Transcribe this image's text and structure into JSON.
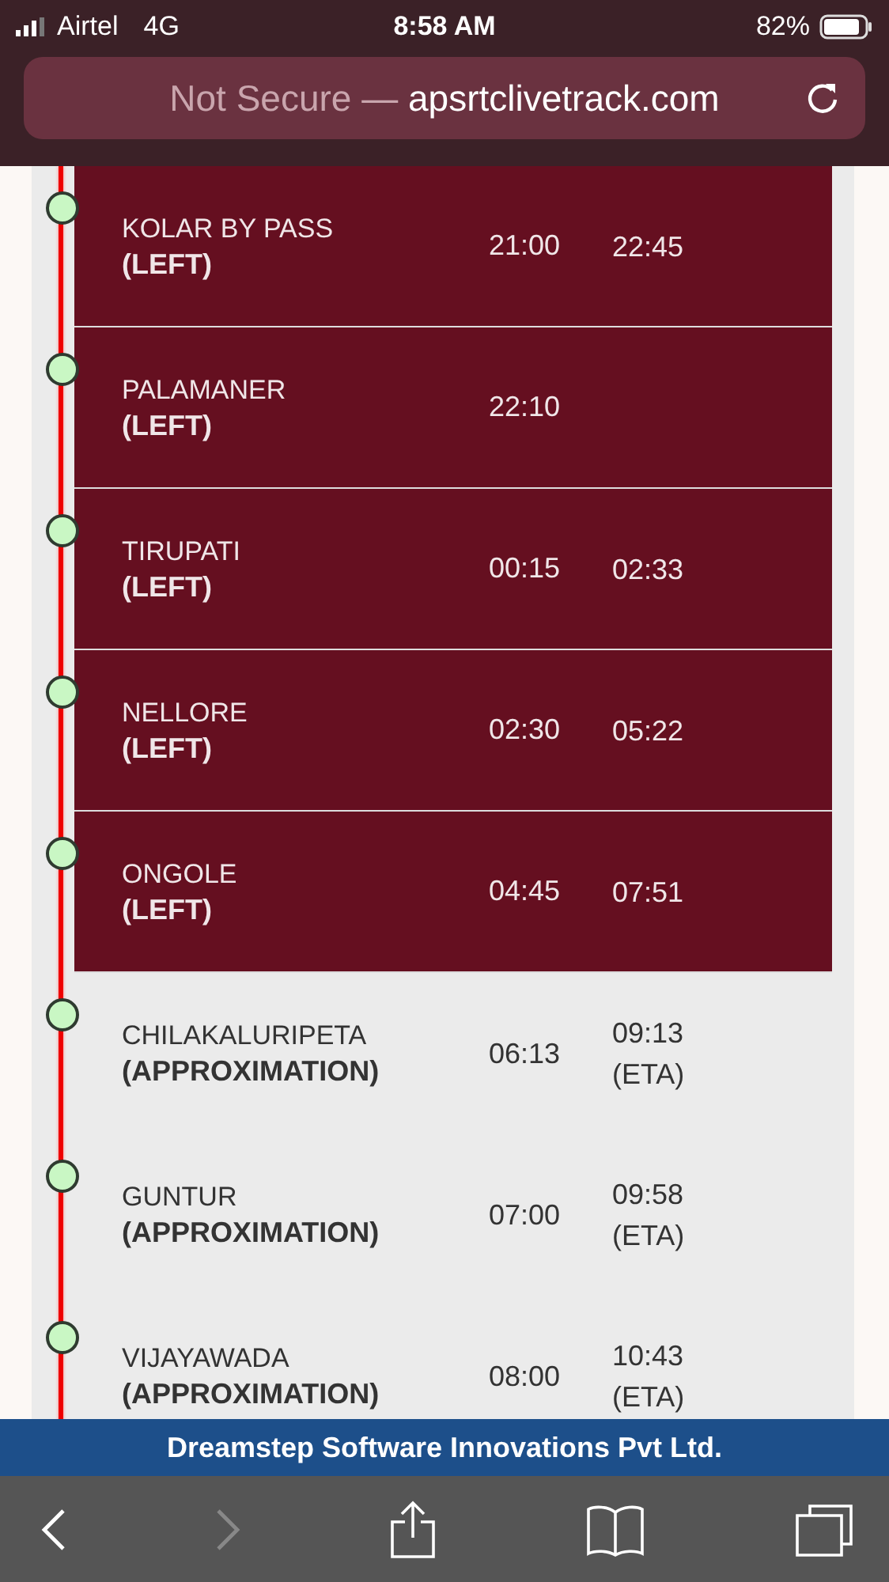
{
  "status_bar": {
    "carrier": "Airtel",
    "network": "4G",
    "time": "8:58 AM",
    "battery": "82%"
  },
  "address_bar": {
    "security": "Not Secure —",
    "domain": "apsrtclivetrack.com"
  },
  "stops": [
    {
      "name": "KOLAR BY PASS",
      "status": "(LEFT)",
      "kind": "left",
      "arrival": "21:00",
      "departure": "22:45"
    },
    {
      "name": "PALAMANER",
      "status": "(LEFT)",
      "kind": "left",
      "arrival": "22:10"
    },
    {
      "name": "TIRUPATI",
      "status": "(LEFT)",
      "kind": "left",
      "arrival": "00:15",
      "departure": "02:33"
    },
    {
      "name": "NELLORE",
      "status": "(LEFT)",
      "kind": "left",
      "arrival": "02:30",
      "departure": "05:22"
    },
    {
      "name": "ONGOLE",
      "status": "(LEFT)",
      "kind": "left",
      "arrival": "04:45",
      "departure": "07:51"
    },
    {
      "name": "CHILAKALURIPETA",
      "status": "(APPROXIMATION)",
      "kind": "approximation",
      "arrival": "06:13",
      "departure": "09:13",
      "departure_note": "(ETA)"
    },
    {
      "name": "GUNTUR",
      "status": "(APPROXIMATION)",
      "kind": "approximation",
      "arrival": "07:00",
      "departure": "09:58",
      "departure_note": "(ETA)"
    },
    {
      "name": "VIJAYAWADA",
      "status": "(APPROXIMATION)",
      "kind": "approximation",
      "arrival": "08:00",
      "departure": "10:43",
      "departure_note": "(ETA)"
    }
  ],
  "footer": "Dreamstep Software Innovations Pvt Ltd.",
  "toolbar": {
    "forward_disabled": true
  }
}
